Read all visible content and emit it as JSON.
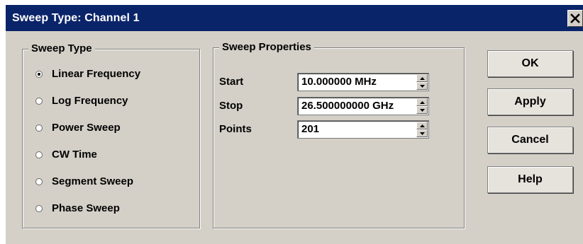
{
  "dialog": {
    "title": "Sweep Type: Channel 1"
  },
  "sweep_type": {
    "legend": "Sweep Type",
    "options": [
      {
        "label": "Linear Frequency",
        "selected": true
      },
      {
        "label": "Log Frequency",
        "selected": false
      },
      {
        "label": "Power Sweep",
        "selected": false
      },
      {
        "label": "CW Time",
        "selected": false
      },
      {
        "label": "Segment Sweep",
        "selected": false
      },
      {
        "label": "Phase Sweep",
        "selected": false
      }
    ]
  },
  "sweep_properties": {
    "legend": "Sweep Properties",
    "start": {
      "label": "Start",
      "value": "10.000000 MHz"
    },
    "stop": {
      "label": "Stop",
      "value": "26.500000000 GHz"
    },
    "points": {
      "label": "Points",
      "value": "201"
    }
  },
  "buttons": {
    "ok": "OK",
    "apply": "Apply",
    "cancel": "Cancel",
    "help": "Help"
  },
  "icons": {
    "close": "close-icon",
    "spin_up": "triangle-up-icon",
    "spin_down": "triangle-down-icon"
  },
  "colors": {
    "titlebar": "#0a246a",
    "dialog_bg": "#d4d0c8"
  }
}
